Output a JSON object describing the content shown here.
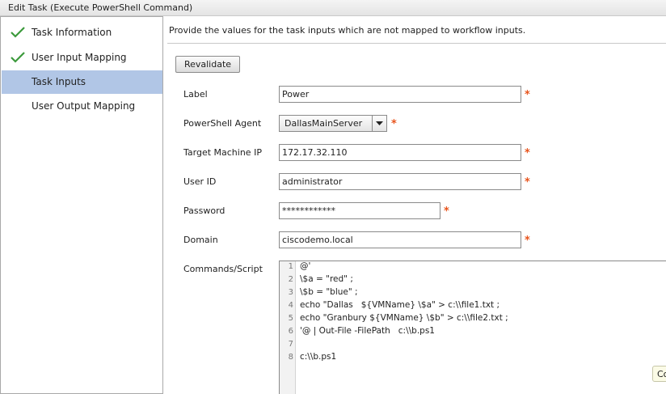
{
  "window": {
    "title": "Edit Task (Execute PowerShell Command)"
  },
  "sidebar": {
    "items": [
      {
        "label": "Task Information",
        "completed": true,
        "active": false
      },
      {
        "label": "User Input Mapping",
        "completed": true,
        "active": false
      },
      {
        "label": "Task Inputs",
        "completed": false,
        "active": true
      },
      {
        "label": "User Output Mapping",
        "completed": false,
        "active": false
      }
    ],
    "check_color": "#3c9a3c",
    "active_color": "#b1c6e6"
  },
  "main": {
    "instructions": "Provide the values for the task inputs which are not mapped to workflow inputs.",
    "revalidate_label": "Revalidate",
    "required_mark": "*",
    "required_color": "#e8541c",
    "fields": {
      "label": {
        "label": "Label",
        "value": "Power"
      },
      "powershell_agent": {
        "label": "PowerShell Agent",
        "value": "DallasMainServer"
      },
      "target_ip": {
        "label": "Target Machine IP",
        "value": "172.17.32.110"
      },
      "user_id": {
        "label": "User ID",
        "value": "administrator"
      },
      "password": {
        "label": "Password",
        "value": "************"
      },
      "domain": {
        "label": "Domain",
        "value": "ciscodemo.local"
      },
      "commands": {
        "label": "Commands/Script",
        "line_numbers": [
          "1",
          "2",
          "3",
          "4",
          "5",
          "6",
          "7",
          "8"
        ],
        "lines": [
          "@'",
          "\\$a = \"red\" ;",
          "\\$b = \"blue\" ;",
          "echo \"Dallas   ${VMName} \\$a\" > c:\\\\file1.txt ;",
          "echo \"Granbury ${VMName} \\$b\" > c:\\\\file2.txt ;",
          "'@ | Out-File -FilePath   c:\\\\b.ps1",
          "",
          "c:\\\\b.ps1"
        ]
      }
    },
    "tooltip_text": "Co"
  }
}
